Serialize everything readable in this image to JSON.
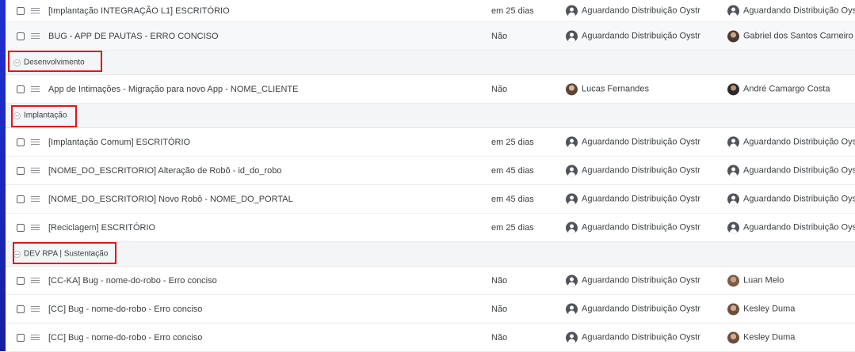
{
  "rows_top": [
    {
      "name": "[Implantação INTEGRAÇÃO L1] ESCRITÓRIO",
      "due": "em 25 dias",
      "assignee": "Aguardando Distribuição Oystr",
      "owner": "Aguardando Distribuição Oystr"
    },
    {
      "name": "BUG - APP DE PAUTAS - ERRO CONCISO",
      "due": "Não",
      "assignee": "Aguardando Distribuição Oystr",
      "owner": "Gabriel dos Santos Carneiro"
    }
  ],
  "groups": [
    {
      "label": "Desenvolvimento",
      "rows": [
        {
          "name": "App de Intimações - Migração para novo App - NOME_CLIENTE",
          "due": "Não",
          "assignee": "Lucas Fernandes",
          "owner": "André Camargo Costa"
        }
      ]
    },
    {
      "label": "Implantação",
      "rows": [
        {
          "name": "[Implantação Comum] ESCRITÓRIO",
          "due": "em 25 dias",
          "assignee": "Aguardando Distribuição Oystr",
          "owner": "Aguardando Distribuição Oystr"
        },
        {
          "name": "[NOME_DO_ESCRITORIO] Alteração de Robô - id_do_robo",
          "due": "em 45 dias",
          "assignee": "Aguardando Distribuição Oystr",
          "owner": "Aguardando Distribuição Oystr"
        },
        {
          "name": "[NOME_DO_ESCRITORIO] Novo Robô - NOME_DO_PORTAL",
          "due": "em 45 dias",
          "assignee": "Aguardando Distribuição Oystr",
          "owner": "Aguardando Distribuição Oystr"
        },
        {
          "name": "[Reciclagem] ESCRITÓRIO",
          "due": "em 25 dias",
          "assignee": "Aguardando Distribuição Oystr",
          "owner": "Aguardando Distribuição Oystr"
        }
      ]
    },
    {
      "label": "DEV RPA | Sustentação",
      "rows": [
        {
          "name": "[CC-KA] Bug - nome-do-robo - Erro conciso",
          "due": "Não",
          "assignee": "Aguardando Distribuição Oystr",
          "owner": "Luan Melo"
        },
        {
          "name": "[CC] Bug - nome-do-robo - Erro conciso",
          "due": "Não",
          "assignee": "Aguardando Distribuição Oystr",
          "owner": "Kesley Duma"
        },
        {
          "name": "[CC] Bug - nome-do-robo - Erro conciso",
          "due": "Não",
          "assignee": "Aguardando Distribuição Oystr",
          "owner": "Kesley Duma"
        }
      ]
    }
  ],
  "colors": {
    "highlight": "#e0151b",
    "left_accent": "#1f2fd0"
  }
}
